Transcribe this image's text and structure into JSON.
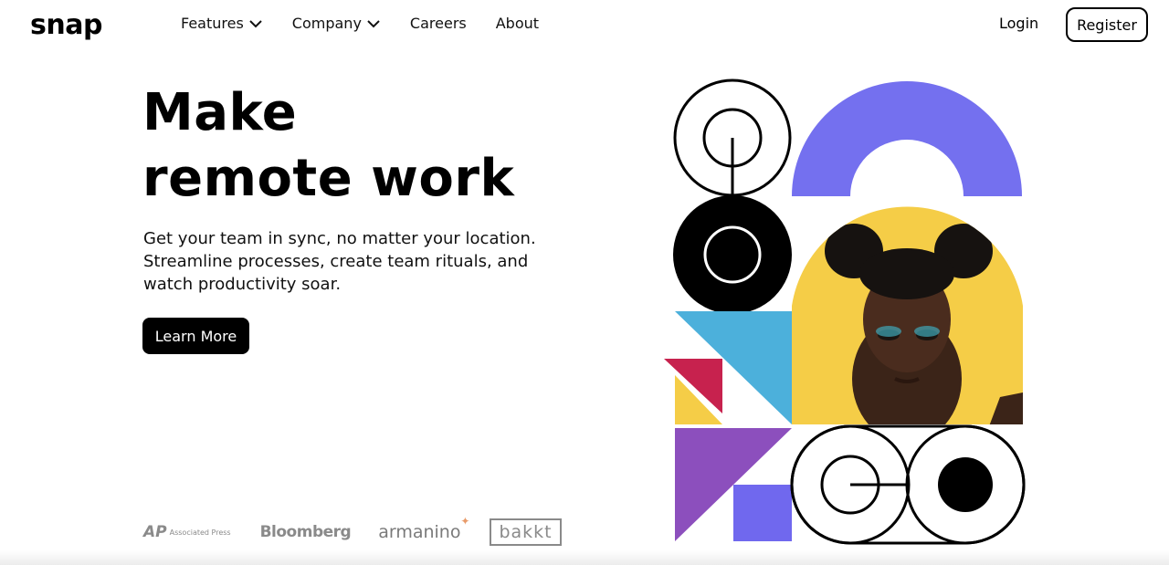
{
  "brand": {
    "logo": "snap"
  },
  "nav": {
    "items": [
      {
        "label": "Features",
        "dropdown": true
      },
      {
        "label": "Company",
        "dropdown": true
      },
      {
        "label": "Careers",
        "dropdown": false
      },
      {
        "label": "About",
        "dropdown": false
      }
    ]
  },
  "auth": {
    "login_label": "Login",
    "register_label": "Register"
  },
  "hero": {
    "headline_line1": "Make",
    "headline_line2": "remote work",
    "subtext": "Get your team in sync, no matter your location. Streamline processes, create team rituals, and watch productivity soar.",
    "cta_label": "Learn More"
  },
  "clients": {
    "ap_mark": "AP",
    "ap_name": "Associated Press",
    "bloomberg": "Bloomberg",
    "armanino": "armanino",
    "bakkt": "bakkt"
  },
  "art": {
    "colors": {
      "purple_arch": "#7470ef",
      "yellow": "#f5cd47",
      "cyan": "#4cb0db",
      "crimson": "#c7224e",
      "violet": "#8c4fbd",
      "blue_square": "#7068ee",
      "black": "#000000"
    }
  }
}
